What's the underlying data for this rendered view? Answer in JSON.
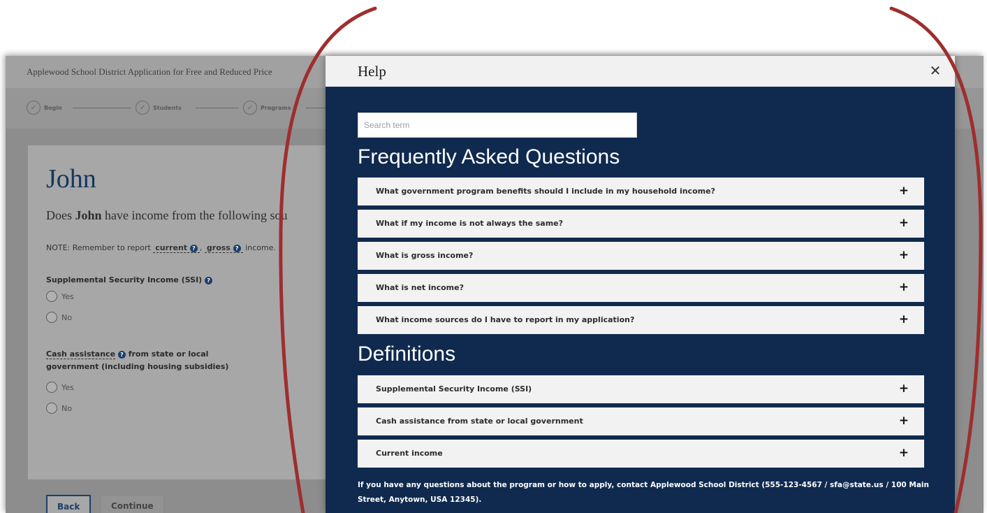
{
  "app": {
    "title": "Applewood School District Application for Free and Reduced Price",
    "steps": [
      {
        "label": "Begin",
        "icon": "check-circle-icon"
      },
      {
        "label": "Students",
        "icon": "check-circle-icon"
      },
      {
        "label": "Programs",
        "icon": "check-circle-icon"
      }
    ],
    "person_name": "John",
    "question_prefix": "Does ",
    "question_name": "John",
    "question_suffix": " have income from the following sou",
    "note_prefix": "NOTE: Remember to report ",
    "note_term_current": "current",
    "note_sep": ", ",
    "note_term_gross": "gross",
    "note_suffix": " income.",
    "fields": [
      {
        "label": "Supplemental Security Income (SSI)",
        "options": [
          "Yes",
          "No"
        ]
      },
      {
        "label_line1": "Cash assistance",
        "label_line1_rest": " from state or local",
        "label_line2": "government (including housing subsidies)",
        "options": [
          "Yes",
          "No"
        ]
      }
    ],
    "back_label": "Back",
    "continue_label": "Continue"
  },
  "help": {
    "title": "Help",
    "close_icon": "close-icon",
    "search_placeholder": "Search term",
    "faq_heading": "Frequently Asked Questions",
    "faq": [
      "What government program benefits should I include in my household income?",
      "What if my income is not always the same?",
      "What is gross income?",
      "What is net income?",
      "What income sources do I have to report in my application?"
    ],
    "definitions_heading": "Definitions",
    "definitions": [
      "Supplemental Security Income (SSI)",
      "Cash assistance from state or local government",
      "Current income"
    ],
    "expand_symbol": "+",
    "footer": "If you have any questions about the program or how to apply, contact Applewood School District (555-123-4567 / sfa@state.us / 100 Main Street, Anytown, USA 12345)."
  },
  "colors": {
    "modal_bg": "#0f2a4e",
    "highlight": "#9e2e2e",
    "name_color": "#14365e"
  }
}
